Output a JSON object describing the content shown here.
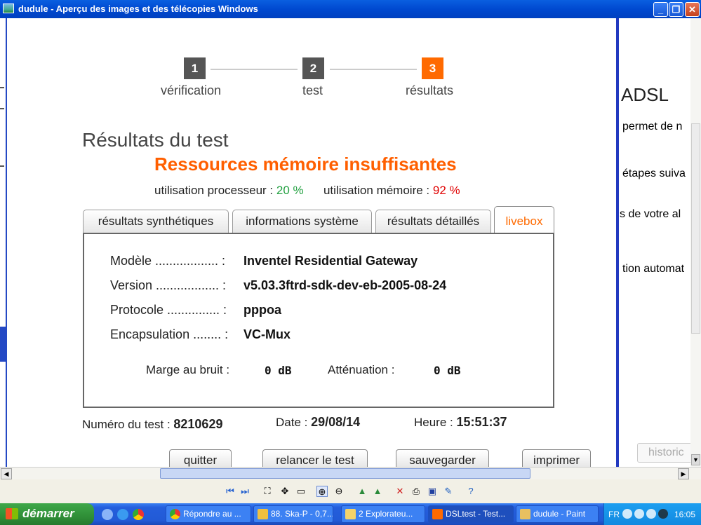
{
  "window": {
    "title": "dudule - Aperçu des images et des télécopies Windows",
    "min": "_",
    "max": "❐",
    "close": "✕"
  },
  "steps": [
    {
      "number": "1",
      "label": "vérification"
    },
    {
      "number": "2",
      "label": "test"
    },
    {
      "number": "3",
      "label": "résultats"
    }
  ],
  "results": {
    "title": "Résultats du test",
    "alert": "Ressources mémoire insuffisantes",
    "cpu_label": "utilisation processeur : ",
    "cpu_value": "20 %",
    "mem_label": "utilisation mémoire : ",
    "mem_value": "92 %"
  },
  "tabs": [
    {
      "label": "résultats synthétiques"
    },
    {
      "label": "informations système"
    },
    {
      "label": "résultats détaillés"
    },
    {
      "label": "livebox"
    }
  ],
  "livebox": {
    "rows": [
      {
        "label": "Modèle .................. :",
        "value": "Inventel Residential Gateway"
      },
      {
        "label": "Version .................. :",
        "value": "v5.03.3ftrd-sdk-dev-eb-2005-08-24"
      },
      {
        "label": "Protocole ............... :",
        "value": "pppoa"
      },
      {
        "label": "Encapsulation ........ :",
        "value": "VC-Mux"
      }
    ],
    "noise_label": "Marge au bruit :",
    "noise_value": "0 dB",
    "atten_label": "Atténuation :",
    "atten_value": "0 dB"
  },
  "meta": {
    "test_label": "Numéro du test : ",
    "test_value": "8210629",
    "date_label": "Date : ",
    "date_value": "29/08/14",
    "time_label": "Heure : ",
    "time_value": "15:51:37"
  },
  "buttons": {
    "quit": "quitter",
    "relaunch": "relancer le test",
    "save": "sauvegarder",
    "print": "imprimer"
  },
  "right_panel": {
    "heading": "ADSL",
    "line1": "permet de n",
    "line2": "étapes suiva",
    "line3": "s de votre al",
    "line4": "tion automat",
    "historic": "historic"
  },
  "taskbar": {
    "start": "démarrer",
    "tasks": [
      "Répondre au ...",
      "88. Ska-P - 0,7...",
      "2 Explorateu...",
      "DSLtest - Test...",
      "dudule - Paint"
    ],
    "lang": "FR",
    "clock": "16:05"
  },
  "colors": {
    "accent": "#ff6a00",
    "ok": "#22a040",
    "warn": "#e00000"
  }
}
